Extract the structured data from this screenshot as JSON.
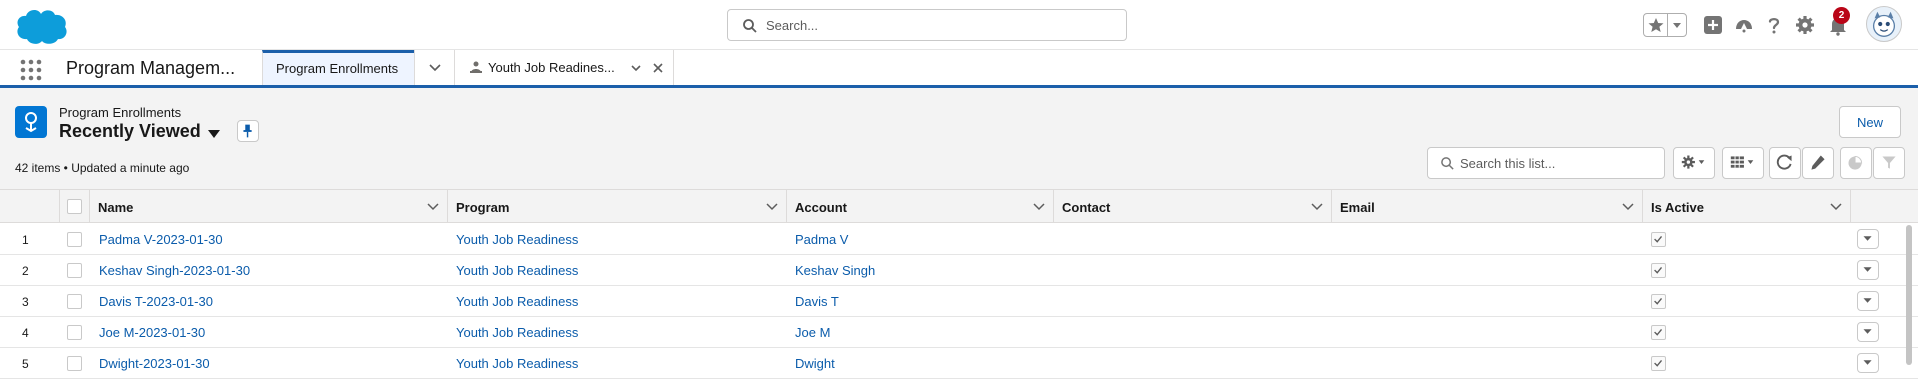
{
  "global_header": {
    "search_placeholder": "Search...",
    "notification_count": "2"
  },
  "app_nav": {
    "app_name": "Program Managem...",
    "tabs": [
      {
        "label": "Program Enrollments",
        "active": true
      },
      {
        "label": "Youth Job Readines...",
        "active": false
      }
    ]
  },
  "list_header": {
    "object_label": "Program Enrollments",
    "view_name": "Recently Viewed",
    "meta": "42 items • Updated a minute ago",
    "new_label": "New",
    "search_placeholder": "Search this list..."
  },
  "table": {
    "columns": [
      "Name",
      "Program",
      "Account",
      "Contact",
      "Email",
      "Is Active"
    ],
    "rows": [
      {
        "num": "1",
        "name": "Padma V-2023-01-30",
        "program": "Youth Job Readiness",
        "account": "Padma V",
        "contact": "",
        "email": "",
        "is_active": true
      },
      {
        "num": "2",
        "name": "Keshav Singh-2023-01-30",
        "program": "Youth Job Readiness",
        "account": "Keshav Singh",
        "contact": "",
        "email": "",
        "is_active": true
      },
      {
        "num": "3",
        "name": "Davis T-2023-01-30",
        "program": "Youth Job Readiness",
        "account": "Davis T",
        "contact": "",
        "email": "",
        "is_active": true
      },
      {
        "num": "4",
        "name": "Joe M-2023-01-30",
        "program": "Youth Job Readiness",
        "account": "Joe M",
        "contact": "",
        "email": "",
        "is_active": true
      },
      {
        "num": "5",
        "name": "Dwight-2023-01-30",
        "program": "Youth Job Readiness",
        "account": "Dwight",
        "contact": "",
        "email": "",
        "is_active": true
      }
    ]
  },
  "colors": {
    "brand": "#0176d3",
    "link": "#0b5cab",
    "badge": "#ba0517"
  },
  "icons": [
    "cloud-logo",
    "search-icon",
    "star-icon",
    "add-icon",
    "trailhead-icon",
    "help-icon",
    "gear-icon",
    "bell-icon",
    "avatar-icon",
    "waffle-icon",
    "pin-icon",
    "settings-icon",
    "table-view-icon",
    "refresh-icon",
    "pencil-icon",
    "chart-icon",
    "filter-icon"
  ]
}
